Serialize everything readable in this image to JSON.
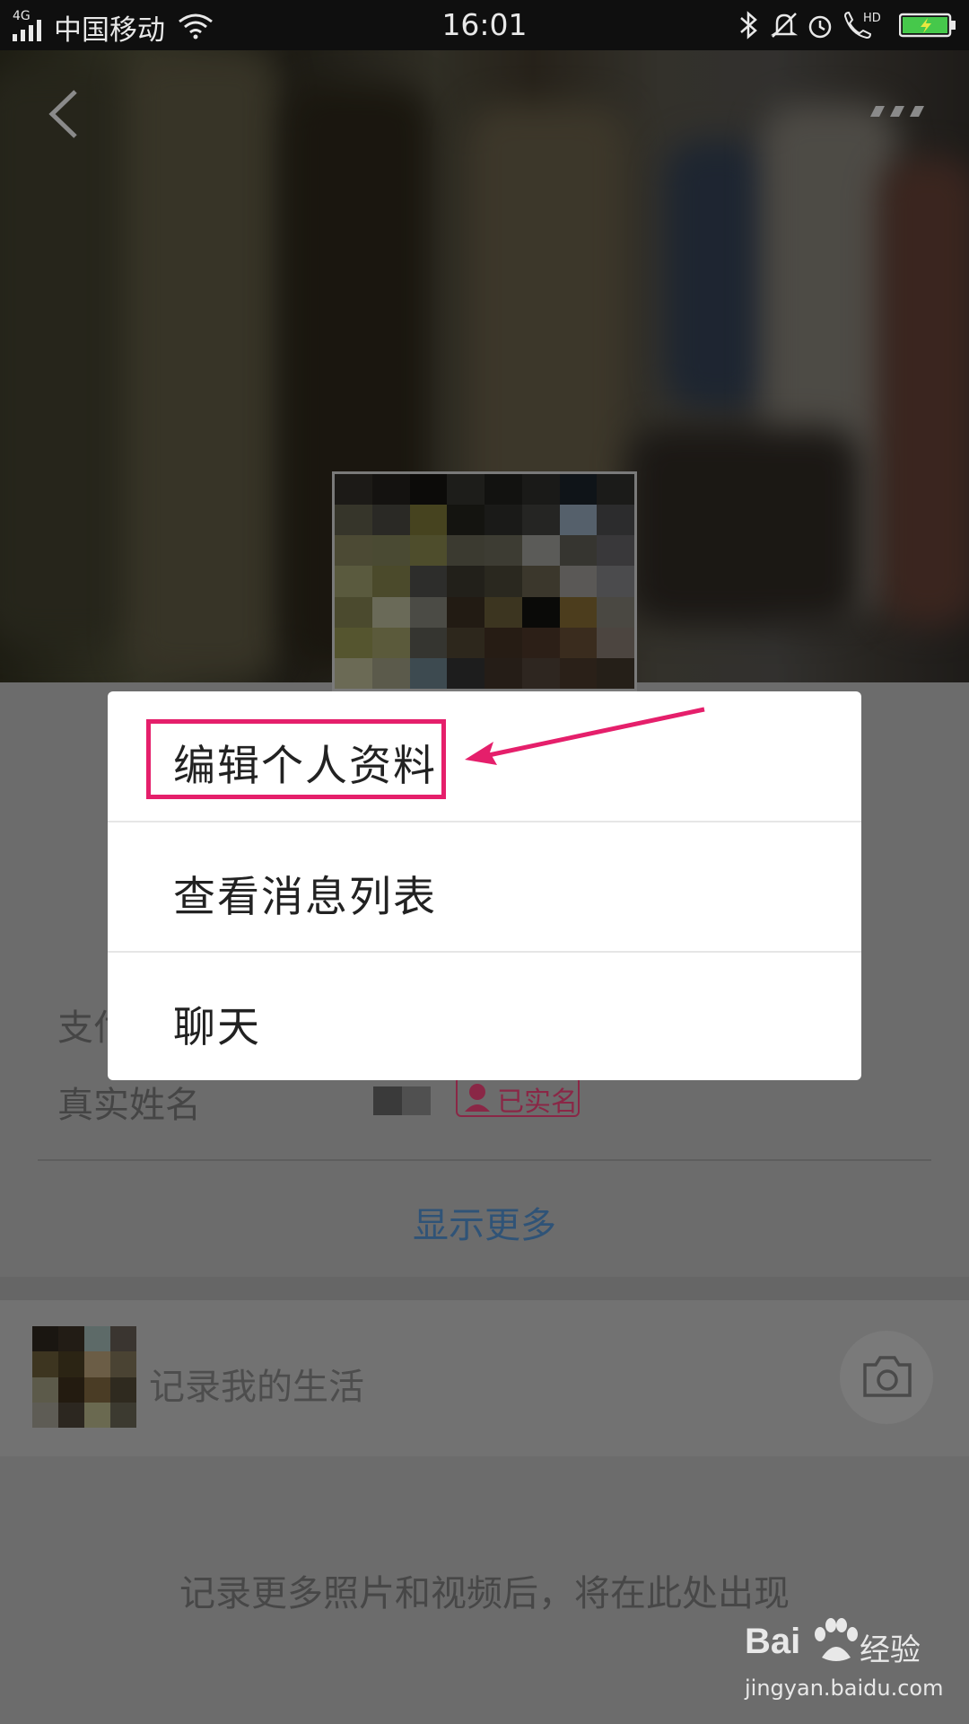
{
  "status_bar": {
    "network": "4G",
    "carrier": "中国移动",
    "time": "16:01",
    "icons": [
      "signal-icon",
      "wifi-icon",
      "bluetooth-icon",
      "mute-bell-icon",
      "alarm-icon",
      "hd-call-icon",
      "battery-charging-icon"
    ]
  },
  "header": {
    "back_icon": "chevron-left-icon",
    "more_icon": "more-dots-icon"
  },
  "menu": {
    "items": [
      {
        "label": "编辑个人资料"
      },
      {
        "label": "查看消息列表"
      },
      {
        "label": "聊天"
      }
    ]
  },
  "profile": {
    "row1_label_partial": "支付",
    "real_name_label": "真实姓名",
    "verified_badge": "已实名",
    "show_more": "显示更多"
  },
  "life": {
    "placeholder": "记录我的生活",
    "camera_icon": "camera-icon"
  },
  "empty_hint": "记录更多照片和视频后，将在此处出现",
  "watermark": {
    "brand_en": "Bai",
    "brand_suffix": "du",
    "brand_cn": "经验",
    "url": "jingyan.baidu.com"
  },
  "colors": {
    "highlight": "#e51f6b",
    "link": "#2f5377",
    "overlay": "rgba(0,0,0,0.55)"
  }
}
